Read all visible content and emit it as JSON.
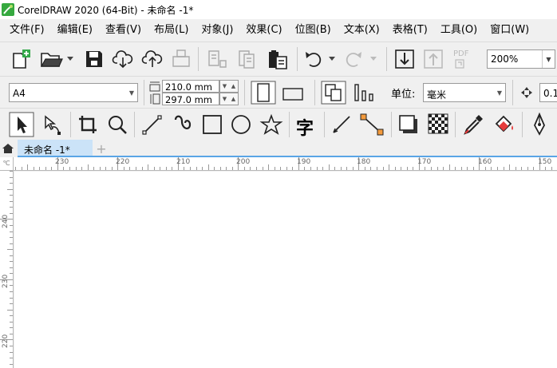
{
  "app": {
    "title": "CorelDRAW 2020 (64-Bit) - 未命名 -1*"
  },
  "menu": [
    {
      "label": "文件(F)"
    },
    {
      "label": "编辑(E)"
    },
    {
      "label": "查看(V)"
    },
    {
      "label": "布局(L)"
    },
    {
      "label": "对象(J)"
    },
    {
      "label": "效果(C)"
    },
    {
      "label": "位图(B)"
    },
    {
      "label": "文本(X)"
    },
    {
      "label": "表格(T)"
    },
    {
      "label": "工具(O)"
    },
    {
      "label": "窗口(W)"
    }
  ],
  "standard_toolbar": {
    "zoom_value": "200%",
    "pdf_label": "PDF"
  },
  "property_bar": {
    "page_size": "A4",
    "width": "210.0 mm",
    "height": "297.0 mm",
    "units_label": "单位:",
    "units_value": "毫米",
    "nudge_value": "0.1"
  },
  "toolbox": {
    "text_tool_glyph": "字"
  },
  "document_tab": {
    "label": "未命名 -1*",
    "add_symbol": "+"
  },
  "ruler": {
    "corner_mark": "℃",
    "h_labels": [
      "230",
      "220",
      "210",
      "200",
      "190",
      "180",
      "170",
      "160",
      "150"
    ],
    "v_labels": [
      "240",
      "230",
      "220"
    ]
  },
  "colors": {
    "accent": "#5aa5e6",
    "tab_bg": "#cbe3f8",
    "chrome": "#f0f0f0",
    "canvas": "#ffffff"
  }
}
